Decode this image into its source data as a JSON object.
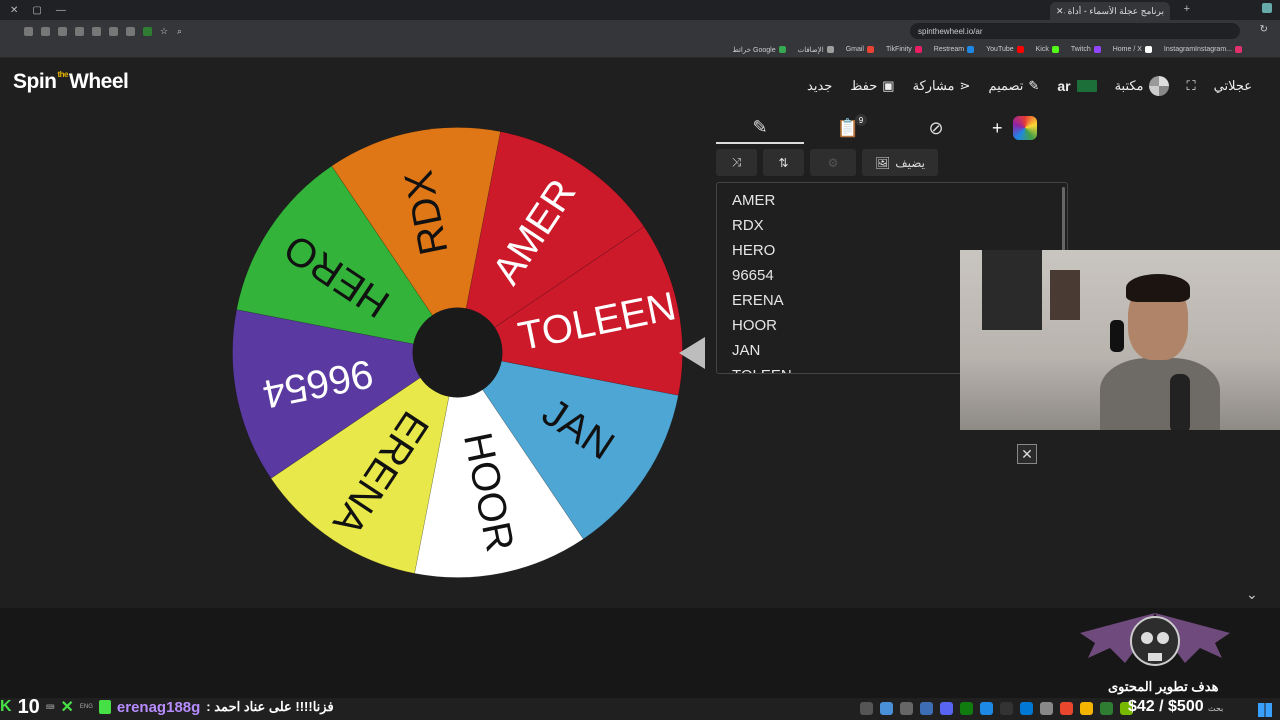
{
  "browser": {
    "tab_title": "برنامج عجلة الأسماء - أداة مخصصة",
    "url": "spinthewheel.io/ar",
    "bookmarks": [
      {
        "label": "خرائط Google",
        "color": "#34a853"
      },
      {
        "label": "الإضافات",
        "color": "#9e9e9e"
      },
      {
        "label": "Gmail",
        "color": "#ea4335"
      },
      {
        "label": "TikFinity",
        "color": "#e91e63"
      },
      {
        "label": "Restream",
        "color": "#1e88e5"
      },
      {
        "label": "YouTube",
        "color": "#ff0000"
      },
      {
        "label": "Kick",
        "color": "#53fc18"
      },
      {
        "label": "Twitch",
        "color": "#9146ff"
      },
      {
        "label": "Home / X",
        "color": "#ffffff"
      },
      {
        "label": "InstagramInstagram...",
        "color": "#e1306c"
      }
    ]
  },
  "site": {
    "logo_pre": "Spin",
    "logo_the": "the",
    "logo_post": "Wheel",
    "nav": {
      "wheels": "عجلاتي",
      "library": "مكتبة",
      "lang": "ar",
      "design": "تصميم",
      "share": "مشاركة",
      "save": "حفظ",
      "new": "جديد"
    }
  },
  "wheel": {
    "segments": [
      {
        "label": "AMER",
        "color": "#cc1a2b",
        "text_color": "#ffffff"
      },
      {
        "label": "TOLEEN",
        "color": "#cc1a2b",
        "text_color": "#ffffff"
      },
      {
        "label": "JAN",
        "color": "#4ea6d4",
        "text_color": "#111111"
      },
      {
        "label": "HOOR",
        "color": "#ffffff",
        "text_color": "#111111"
      },
      {
        "label": "ERENA",
        "color": "#e8e84a",
        "text_color": "#111111"
      },
      {
        "label": "96654",
        "color": "#5a3aa0",
        "text_color": "#ffffff"
      },
      {
        "label": "HERO",
        "color": "#33b33a",
        "text_color": "#111111"
      },
      {
        "label": "RDX",
        "color": "#e07717",
        "text_color": "#111111"
      }
    ]
  },
  "panel": {
    "entries_count": "9",
    "add_image_label": "يضيف",
    "entries": [
      "AMER",
      "RDX",
      "HERO",
      "96654",
      "ERENA",
      "HOOR",
      "JAN",
      "TOLEEN"
    ]
  },
  "stream": {
    "goal_label": "هدف تطوير المحتوى",
    "goal_amount": "$42 / $500",
    "counter": "10",
    "chat_user": "erenag188g",
    "chat_msg": "فزنا!!!! على عناد احمد :",
    "taskbar_search": "بحث"
  }
}
